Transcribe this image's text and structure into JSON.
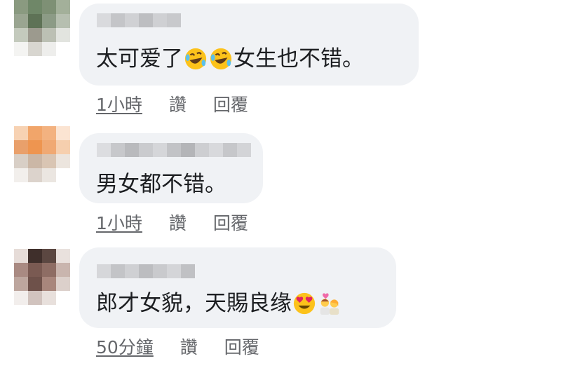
{
  "comments": [
    {
      "text": "太可爱了",
      "text_after": "女生也不错。",
      "emojis": [
        "rolling-on-floor-laughing",
        "rolling-on-floor-laughing"
      ],
      "time": "1小時",
      "like_label": "讚",
      "reply_label": "回覆"
    },
    {
      "text": "男女都不错。",
      "time": "1小時",
      "like_label": "讚",
      "reply_label": "回覆"
    },
    {
      "text": "郎才女貌，天賜良缘",
      "emojis": [
        "smiling-face-with-heart-eyes",
        "couple-with-heart"
      ],
      "time": "50分鐘",
      "like_label": "讚",
      "reply_label": "回覆"
    }
  ],
  "colors": {
    "bubble": "#f0f2f5",
    "text": "#1c1e21",
    "meta": "#65676b"
  }
}
